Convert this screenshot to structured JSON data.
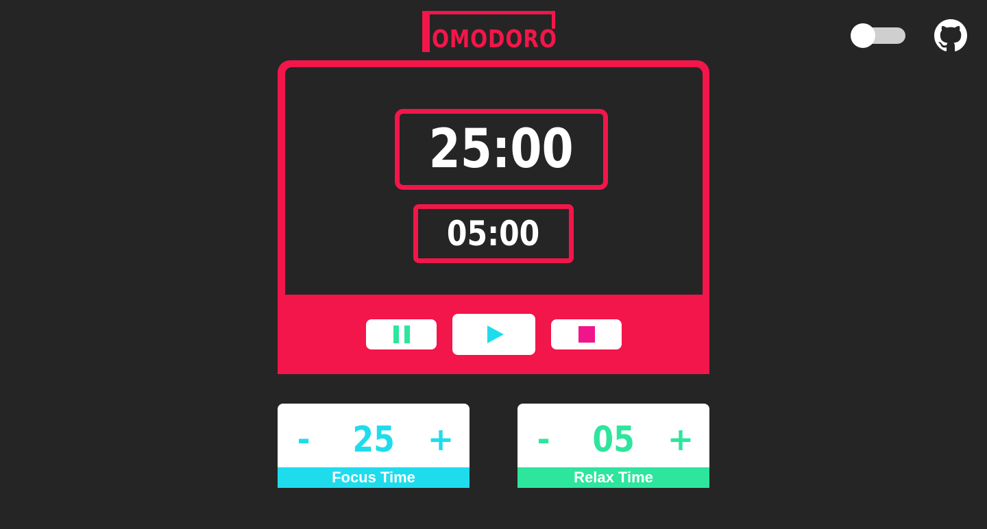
{
  "header": {
    "logo_text": "OMODORO",
    "theme_toggle": {
      "state": "off"
    },
    "github_icon": "github-icon"
  },
  "timer": {
    "focus_display": "25:00",
    "relax_display": "05:00"
  },
  "controls": {
    "pause_icon": "pause-icon",
    "play_icon": "play-icon",
    "stop_icon": "stop-icon"
  },
  "settings": {
    "focus": {
      "minus": "-",
      "value": "25",
      "plus": "+",
      "label": "Focus Time"
    },
    "relax": {
      "minus": "-",
      "value": "05",
      "plus": "+",
      "label": "Relax Time"
    }
  },
  "colors": {
    "background": "#252525",
    "accent": "#f2164a",
    "focus": "#1fdced",
    "relax": "#2ee59d",
    "stop": "#f0158a"
  }
}
